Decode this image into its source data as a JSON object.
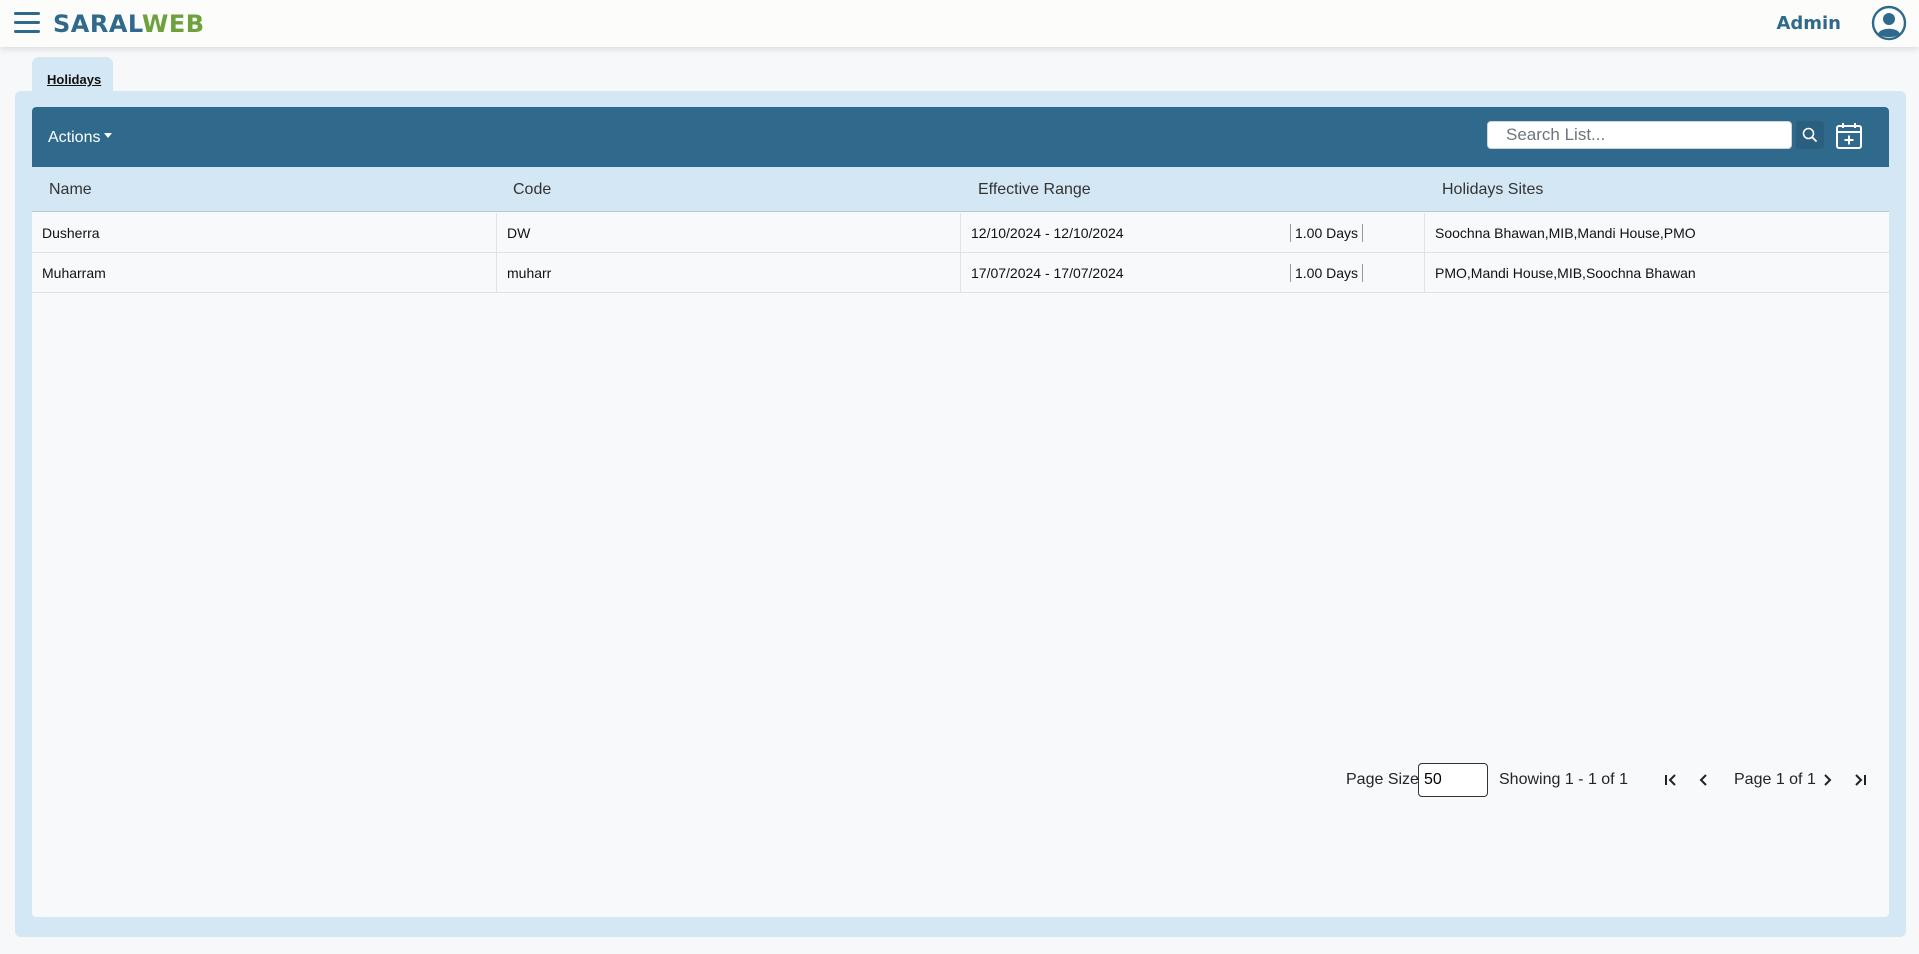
{
  "brand": {
    "part1": "SARAL",
    "part2": "WEB"
  },
  "user": {
    "name": "Admin"
  },
  "tabs": [
    {
      "label": "Holidays"
    }
  ],
  "toolbar": {
    "actions_label": "Actions",
    "search_placeholder": "Search List...",
    "search_value": ""
  },
  "table": {
    "columns": [
      "Name",
      "Code",
      "Effective Range",
      "Holidays Sites"
    ],
    "rows": [
      {
        "name": "Dusherra",
        "code": "DW",
        "range": "12/10/2024 - 12/10/2024",
        "days": "1.00 Days",
        "sites": "Soochna Bhawan,MIB,Mandi House,PMO"
      },
      {
        "name": "Muharram",
        "code": "muharr",
        "range": "17/07/2024 - 17/07/2024",
        "days": "1.00 Days",
        "sites": "PMO,Mandi House,MIB,Soochna Bhawan"
      }
    ]
  },
  "pagination": {
    "page_size_label": "Page Size",
    "page_size_value": "50",
    "showing": "Showing 1 - 1 of 1",
    "page_of": "Page 1 of 1"
  },
  "colors": {
    "primary": "#2f6a8d",
    "accent": "#6ca13b",
    "light": "#d4e7f4"
  }
}
